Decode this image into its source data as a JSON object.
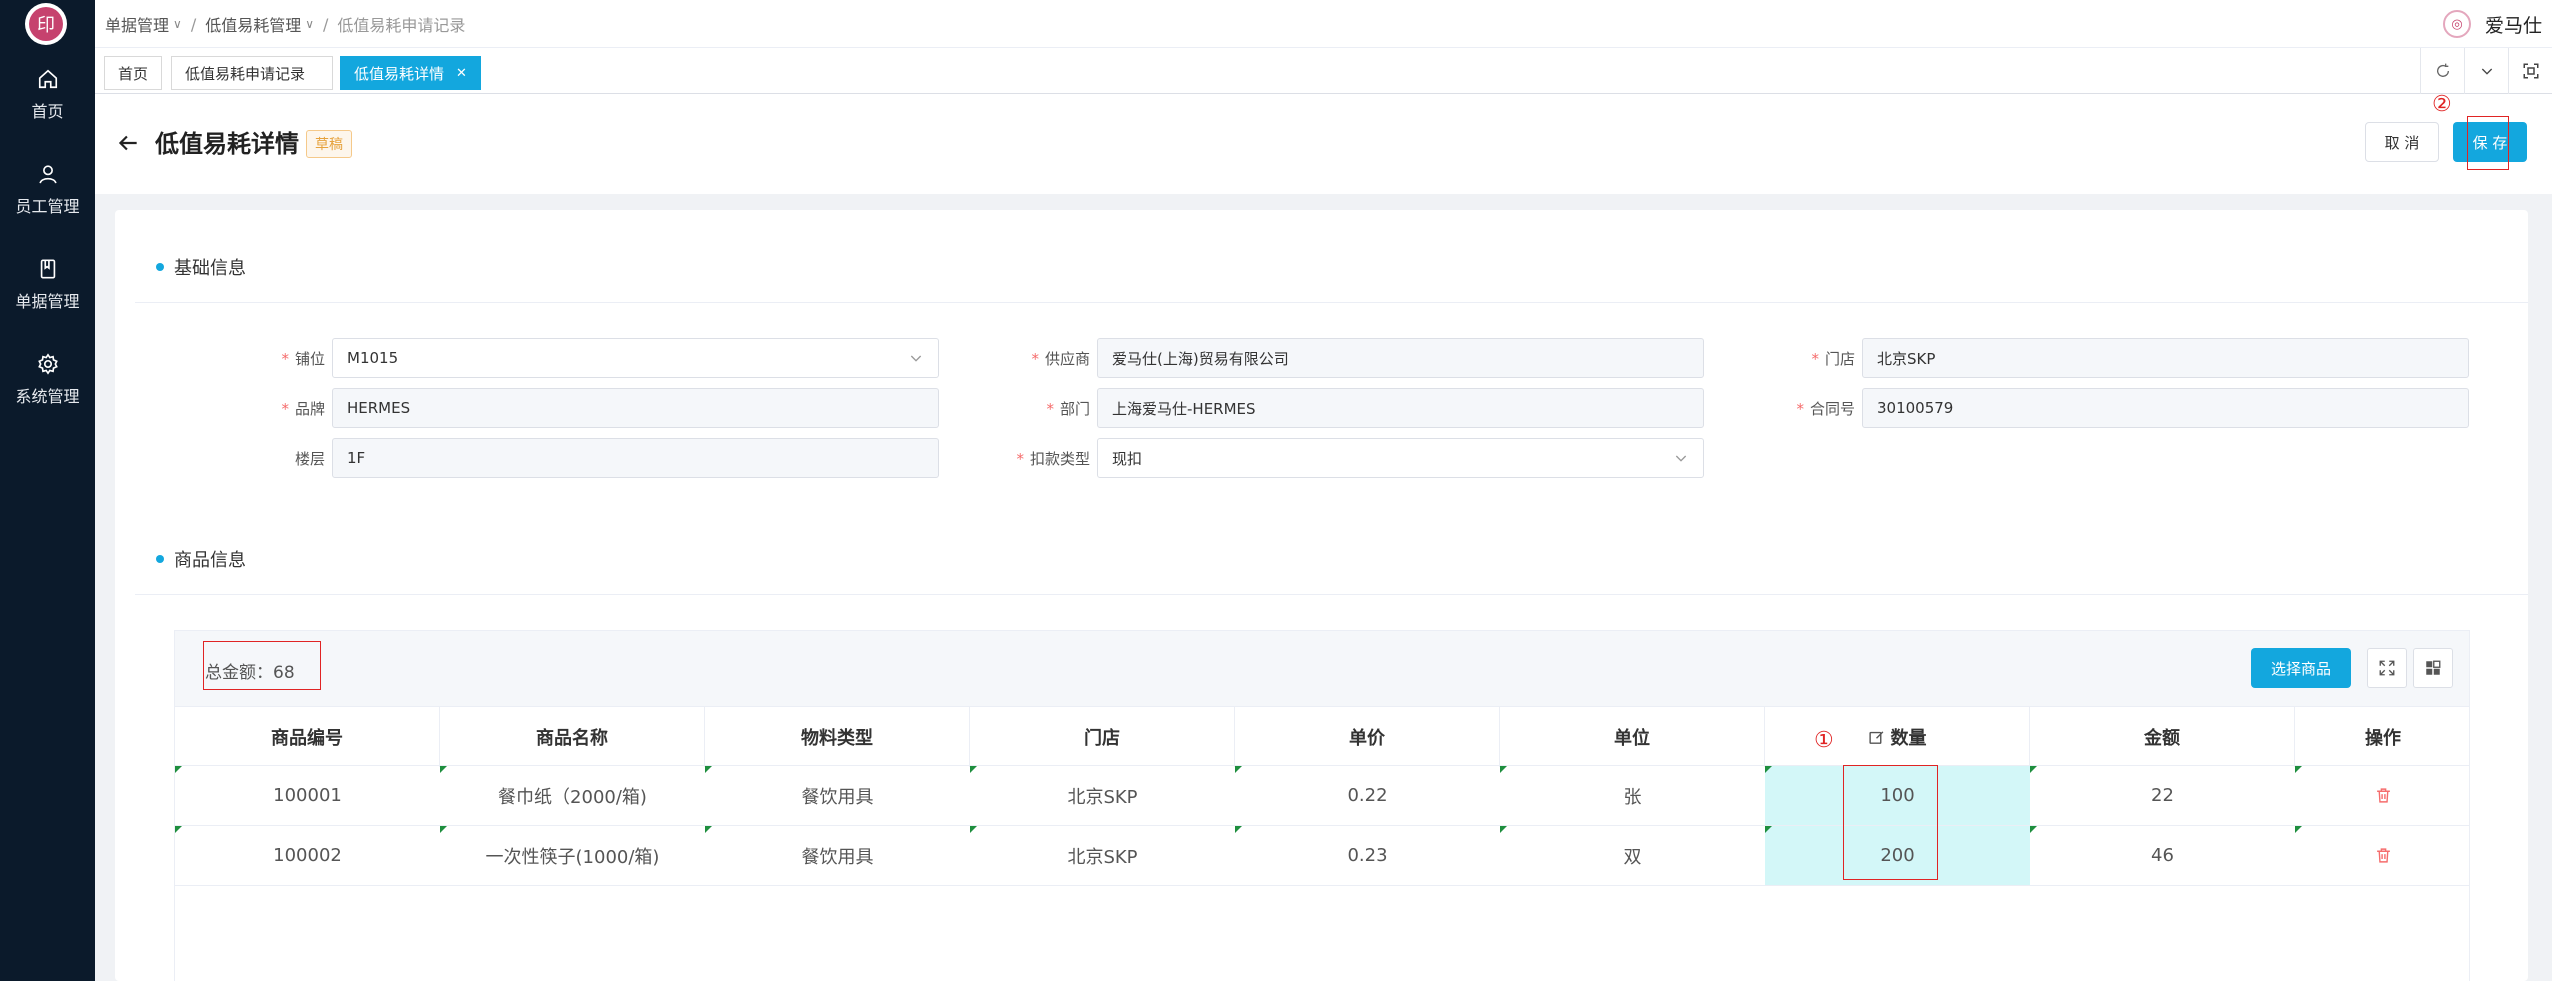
{
  "sidebar": {
    "logo_text": "印",
    "items": [
      {
        "label": "首页",
        "icon": "home-icon"
      },
      {
        "label": "员工管理",
        "icon": "user-icon"
      },
      {
        "label": "单据管理",
        "icon": "book-icon"
      },
      {
        "label": "系统管理",
        "icon": "gear-icon"
      }
    ]
  },
  "breadcrumb": [
    "单据管理",
    "低值易耗管理",
    "低值易耗申请记录"
  ],
  "brand": {
    "name": "爱马仕"
  },
  "tabs": [
    {
      "label": "首页"
    },
    {
      "label": "低值易耗申请记录"
    },
    {
      "label": "低值易耗详情",
      "active": true
    }
  ],
  "header": {
    "title": "低值易耗详情",
    "status": "草稿",
    "cancel_label": "取 消",
    "save_label": "保 存",
    "mark_save": "②"
  },
  "basic_info": {
    "title": "基础信息",
    "fields": {
      "booth": {
        "label": "铺位",
        "value": "M1015"
      },
      "supplier": {
        "label": "供应商",
        "value": "爱马仕(上海)贸易有限公司"
      },
      "store": {
        "label": "门店",
        "value": "北京SKP"
      },
      "brand": {
        "label": "品牌",
        "value": "HERMES"
      },
      "dept": {
        "label": "部门",
        "value": "上海爱马仕-HERMES"
      },
      "contract": {
        "label": "合同号",
        "value": "30100579"
      },
      "floor": {
        "label": "楼层",
        "value": "1F"
      },
      "deduction": {
        "label": "扣款类型",
        "value": "现扣"
      }
    }
  },
  "goods_info": {
    "title": "商品信息",
    "total_label": "总金额：68",
    "select_button": "选择商品",
    "mark_qty": "①",
    "columns": [
      "商品编号",
      "商品名称",
      "物料类型",
      "门店",
      "单价",
      "单位",
      "数量",
      "金额",
      "操作"
    ],
    "rows": [
      {
        "code": "100001",
        "name": "餐巾纸（2000/箱)",
        "type": "餐饮用具",
        "store": "北京SKP",
        "price": "0.22",
        "unit": "张",
        "qty": "100",
        "amount": "22"
      },
      {
        "code": "100002",
        "name": "一次性筷子(1000/箱)",
        "type": "餐饮用具",
        "store": "北京SKP",
        "price": "0.23",
        "unit": "双",
        "qty": "200",
        "amount": "46"
      }
    ]
  },
  "colors": {
    "primary": "#13a7de",
    "sidebar": "#0b1a2b",
    "danger": "#f56c6c",
    "qty_bg": "#d3f7f8",
    "annotation": "#e02424"
  }
}
